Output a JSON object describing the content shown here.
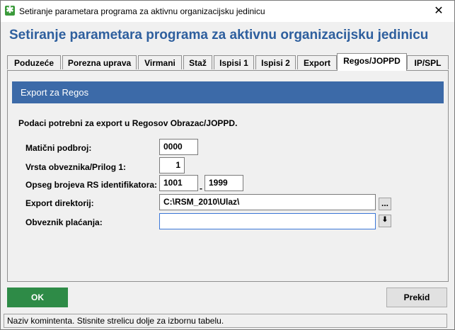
{
  "window": {
    "title": "Setiranje parametara programa za aktivnu organizacijsku jedinicu",
    "close_glyph": "✕",
    "icon": "app-icon"
  },
  "header": {
    "title": "Setiranje parametara programa za aktivnu organizacijsku jedinicu"
  },
  "tabs": [
    {
      "label": "Poduzeće"
    },
    {
      "label": "Porezna uprava"
    },
    {
      "label": "Virmani"
    },
    {
      "label": "Staž"
    },
    {
      "label": "Ispisi 1"
    },
    {
      "label": "Ispisi 2"
    },
    {
      "label": "Export"
    },
    {
      "label": "Regos/JOPPD",
      "active": true
    },
    {
      "label": "IP/SPL"
    }
  ],
  "panel": {
    "title": "Export za Regos",
    "description": "Podaci potrebni za export u Regosov Obrazac/JOPPD."
  },
  "form": {
    "maticni_label": "Matični podbroj:",
    "maticni_value": "0000",
    "vrsta_label": "Vrsta obveznika/Prilog 1:",
    "vrsta_value": "1",
    "opseg_label": "Opseg brojeva RS identifikatora:",
    "opseg_from": "1001",
    "opseg_sep": "-",
    "opseg_to": "1999",
    "export_label": "Export direktorij:",
    "export_value": "C:\\RSM_2010\\Ulaz\\",
    "browse_glyph": "...",
    "obveznik_label": "Obveznik plaćanja:",
    "obveznik_value": "",
    "dropdown_glyph": "⬇"
  },
  "buttons": {
    "ok": "OK",
    "prekid": "Prekid"
  },
  "status": {
    "text": "Naziv komintenta. Stisnite strelicu dolje za izbornu tabelu."
  },
  "colors": {
    "accent": "#2e5f9e",
    "panel_header": "#3c6aa8",
    "ok": "#2e8b47"
  }
}
